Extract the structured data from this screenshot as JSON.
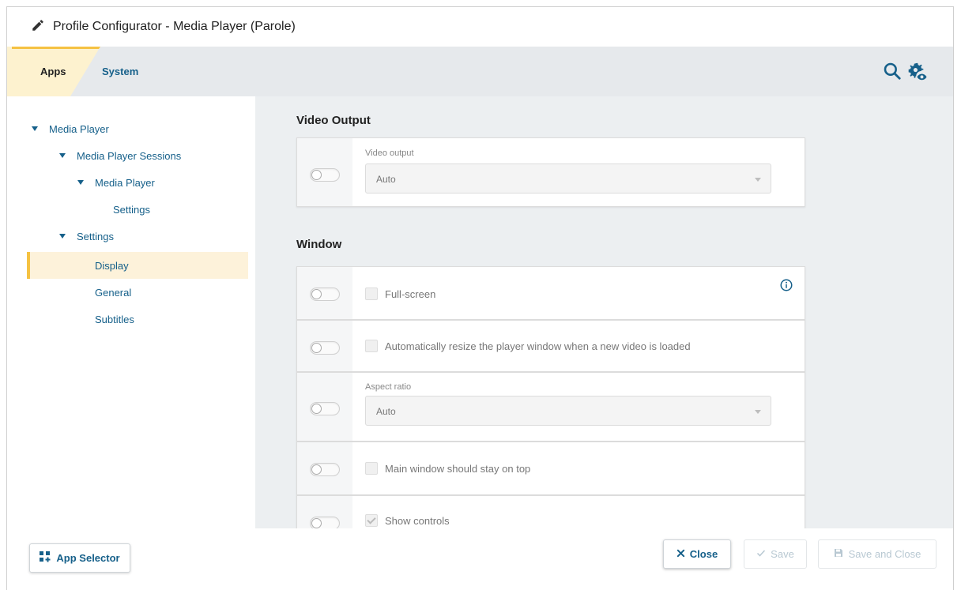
{
  "window": {
    "title": "Profile Configurator  - Media Player (Parole)"
  },
  "tabs": {
    "apps_label": "Apps",
    "system_label": "System"
  },
  "tree": {
    "items": [
      {
        "label": "Media Player"
      },
      {
        "label": "Media Player Sessions"
      },
      {
        "label": "Media Player"
      },
      {
        "label": "Settings"
      },
      {
        "label": "Settings"
      },
      {
        "label": "Display"
      },
      {
        "label": "General"
      },
      {
        "label": "Subtitles"
      }
    ]
  },
  "sections": {
    "video_output": {
      "title": "Video Output",
      "field_label": "Video output",
      "value": "Auto"
    },
    "window": {
      "title": "Window",
      "fullscreen_label": "Full-screen",
      "auto_resize_label": "Automatically resize the player window when a new video is loaded",
      "aspect_ratio_label": "Aspect ratio",
      "aspect_ratio_value": "Auto",
      "stay_on_top_label": "Main window should stay on top",
      "show_controls_label": "Show controls"
    }
  },
  "footer": {
    "app_selector_label": "App Selector",
    "close_label": "Close",
    "save_label": "Save",
    "save_close_label": "Save and Close"
  },
  "colors": {
    "accent": "#16608a",
    "highlight": "#f5c242",
    "selected_bg": "#fdf2da"
  }
}
